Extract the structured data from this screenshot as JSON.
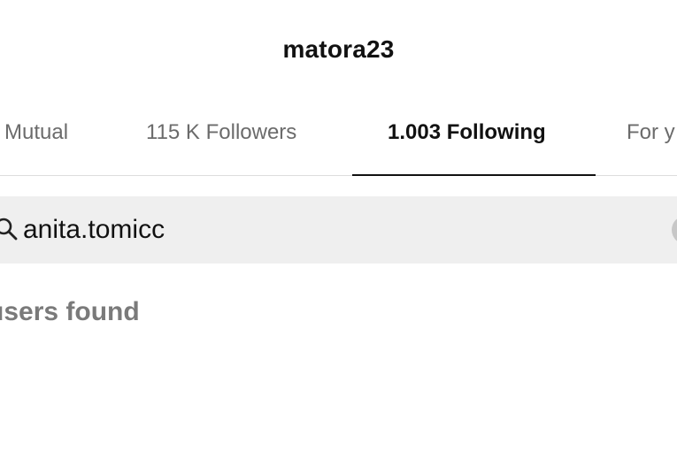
{
  "header": {
    "username": "matora23"
  },
  "tabs": [
    {
      "label": "Mutual",
      "active": false
    },
    {
      "label": "115 K Followers",
      "active": false
    },
    {
      "label": "1.003 Following",
      "active": true
    },
    {
      "label": "For y",
      "active": false
    }
  ],
  "search": {
    "value": "anita.tomicc",
    "icon": "search-icon",
    "clear_icon": "clear-icon"
  },
  "results": {
    "message": "users found"
  },
  "colors": {
    "active_tab": "#111111",
    "inactive_tab": "#6b6b6b",
    "search_bg": "#efefef",
    "muted_text": "#7a7a7a"
  }
}
